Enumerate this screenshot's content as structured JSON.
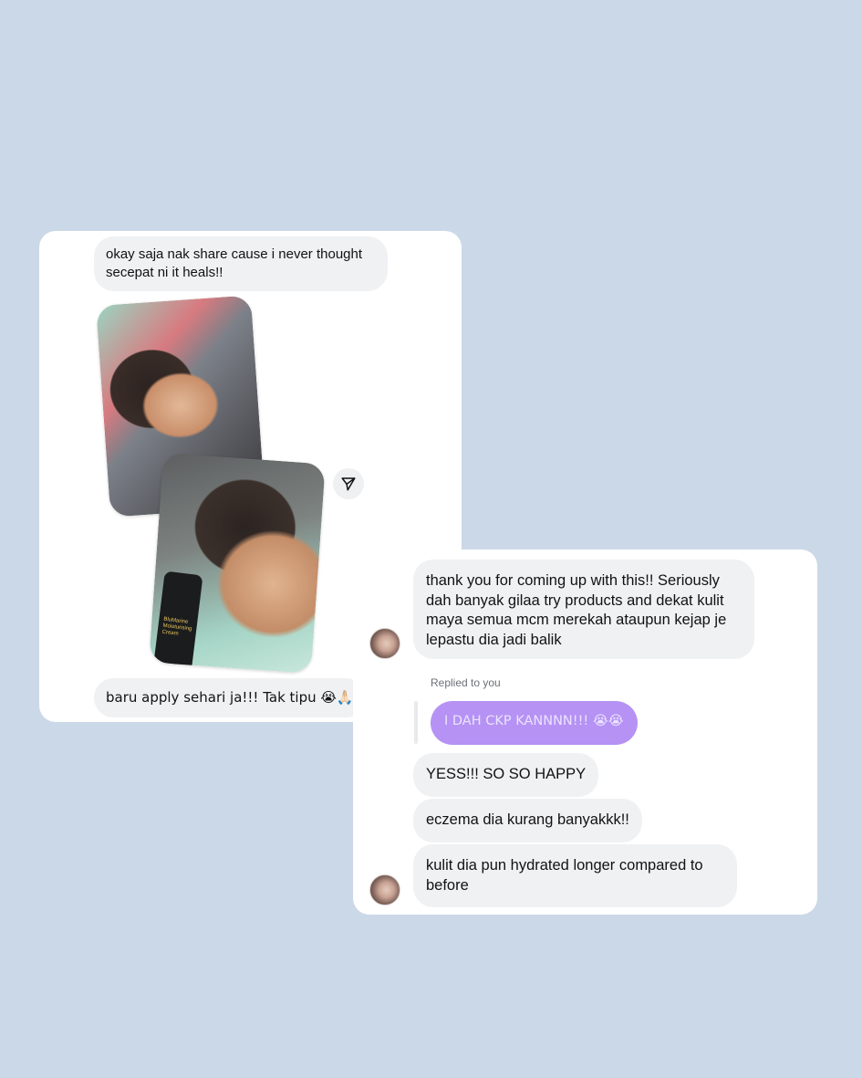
{
  "conversation_a": {
    "messages": [
      {
        "text": "okay saja nak share cause i never thought secepat ni it heals!!"
      },
      {
        "text": "baru apply sehari ja!!! Tak tipu 😭🙏🏻"
      }
    ],
    "photos": [
      {
        "description": ""
      },
      {
        "description": "",
        "product_label": "BluMarine Moisturising Cream"
      }
    ],
    "share_icon": "send-icon"
  },
  "conversation_b": {
    "messages": [
      {
        "text": "thank you for coming up with this!! Seriously dah banyak gilaa try products and dekat kulit maya semua mcm merekah ataupun kejap je lepastu dia jadi balik"
      },
      {
        "text": "YESS!!! SO SO HAPPY"
      },
      {
        "text": "eczema dia kurang banyakkk!!"
      },
      {
        "text": "kulit dia pun hydrated longer compared to before"
      }
    ],
    "reply": {
      "label": "Replied to you",
      "text": "I DAH CKP KANNNN!!! 😭😭",
      "color": "#b592f4"
    }
  },
  "colors": {
    "background": "#cbd8e7",
    "bubble": "#f0f1f3",
    "card": "#ffffff"
  }
}
